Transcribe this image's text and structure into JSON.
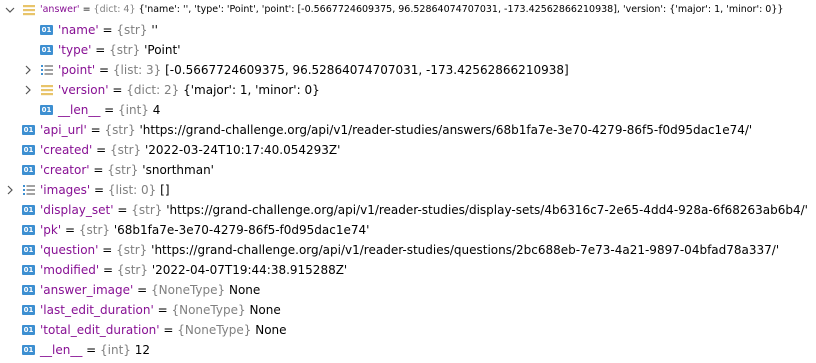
{
  "colors": {
    "key": "#871094",
    "type": "#808080",
    "value": "#000000",
    "int_badge": "#3d8fd1",
    "dict_icon": "#e8c46a",
    "list_icon": "#3d8fd1"
  },
  "badge_text": "01",
  "rows": [
    {
      "id": "answer",
      "indent": 0,
      "icon": "dict-icon",
      "expand": "expanded",
      "key": "'answer'",
      "type": "{dict: 4}",
      "value": "{'name': '', 'type': 'Point', 'point': [-0.5667724609375, 96.52864074707031, -173.42562866210938], 'version': {'major': 1, 'minor': 0}}"
    },
    {
      "id": "name",
      "indent": 1,
      "icon": "int-badge",
      "expand": "none",
      "key": "'name'",
      "type": "{str}",
      "value": "''"
    },
    {
      "id": "type",
      "indent": 1,
      "icon": "int-badge",
      "expand": "none",
      "key": "'type'",
      "type": "{str}",
      "value": "'Point'"
    },
    {
      "id": "point",
      "indent": 1,
      "icon": "list-icon",
      "expand": "collapsed",
      "key": "'point'",
      "type": "{list: 3}",
      "value": "[-0.5667724609375, 96.52864074707031, -173.42562866210938]"
    },
    {
      "id": "version",
      "indent": 1,
      "icon": "dict-icon",
      "expand": "collapsed",
      "key": "'version'",
      "type": "{dict: 2}",
      "value": "{'major': 1, 'minor': 0}"
    },
    {
      "id": "len-inner",
      "indent": 1,
      "icon": "int-badge",
      "expand": "none",
      "key": "__len__",
      "type": "{int}",
      "value": "4"
    },
    {
      "id": "api-url",
      "indent": 0,
      "icon": "int-badge",
      "expand": "none",
      "key": "'api_url'",
      "type": "{str}",
      "value": "'https://grand-challenge.org/api/v1/reader-studies/answers/68b1fa7e-3e70-4279-86f5-f0d95dac1e74/'"
    },
    {
      "id": "created",
      "indent": 0,
      "icon": "int-badge",
      "expand": "none",
      "key": "'created'",
      "type": "{str}",
      "value": "'2022-03-24T10:17:40.054293Z'"
    },
    {
      "id": "creator",
      "indent": 0,
      "icon": "int-badge",
      "expand": "none",
      "key": "'creator'",
      "type": "{str}",
      "value": "'snorthman'"
    },
    {
      "id": "images",
      "indent": 0,
      "icon": "list-icon",
      "expand": "collapsed",
      "key": "'images'",
      "type": "{list: 0}",
      "value": "[]"
    },
    {
      "id": "display-set",
      "indent": 0,
      "icon": "int-badge",
      "expand": "none",
      "key": "'display_set'",
      "type": "{str}",
      "value": "'https://grand-challenge.org/api/v1/reader-studies/display-sets/4b6316c7-2e65-4dd4-928a-6f68263ab6b4/'"
    },
    {
      "id": "pk",
      "indent": 0,
      "icon": "int-badge",
      "expand": "none",
      "key": "'pk'",
      "type": "{str}",
      "value": "'68b1fa7e-3e70-4279-86f5-f0d95dac1e74'"
    },
    {
      "id": "question",
      "indent": 0,
      "icon": "int-badge",
      "expand": "none",
      "key": "'question'",
      "type": "{str}",
      "value": "'https://grand-challenge.org/api/v1/reader-studies/questions/2bc688eb-7e73-4a21-9897-04bfad78a337/'"
    },
    {
      "id": "modified",
      "indent": 0,
      "icon": "int-badge",
      "expand": "none",
      "key": "'modified'",
      "type": "{str}",
      "value": "'2022-04-07T19:44:38.915288Z'"
    },
    {
      "id": "answer-image",
      "indent": 0,
      "icon": "int-badge",
      "expand": "none",
      "key": "'answer_image'",
      "type": "{NoneType}",
      "value": "None"
    },
    {
      "id": "last-edit-duration",
      "indent": 0,
      "icon": "int-badge",
      "expand": "none",
      "key": "'last_edit_duration'",
      "type": "{NoneType}",
      "value": "None"
    },
    {
      "id": "total-edit-duration",
      "indent": 0,
      "icon": "int-badge",
      "expand": "none",
      "key": "'total_edit_duration'",
      "type": "{NoneType}",
      "value": "None"
    },
    {
      "id": "len-outer",
      "indent": 0,
      "icon": "int-badge",
      "expand": "none",
      "key": "__len__",
      "type": "{int}",
      "value": "12"
    }
  ]
}
